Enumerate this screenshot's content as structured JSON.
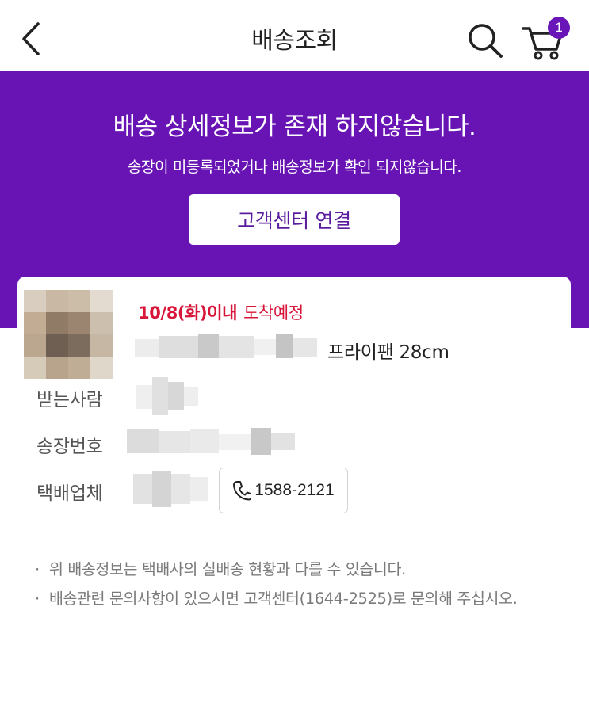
{
  "header": {
    "title": "배송조회",
    "cart_count": "1"
  },
  "banner": {
    "title": "배송 상세정보가 존재 하지않습니다.",
    "subtitle": "송장이 미등록되었거나 배송정보가 확인 되지않습니다.",
    "cs_button_label": "고객센터 연결"
  },
  "order": {
    "eta_date": "10/8(화)이내",
    "eta_status": "도착예정",
    "product_name": "프라이팬 28cm",
    "recipient_label": "받는사람",
    "invoice_label": "송장번호",
    "courier_label": "택배업체",
    "courier_phone": "1588-2121"
  },
  "notes": {
    "bullet": "·",
    "items": [
      "위 배송정보는 택배사의 실배송 현황과 다를 수 있습니다.",
      "배송관련 문의사항이 있으시면 고객센터(1644-2525)로 문의해 주십시오."
    ]
  },
  "colors": {
    "brand_purple": "#6813b3",
    "eta_red": "#d8163a",
    "badge_purple": "#6a15b8"
  }
}
